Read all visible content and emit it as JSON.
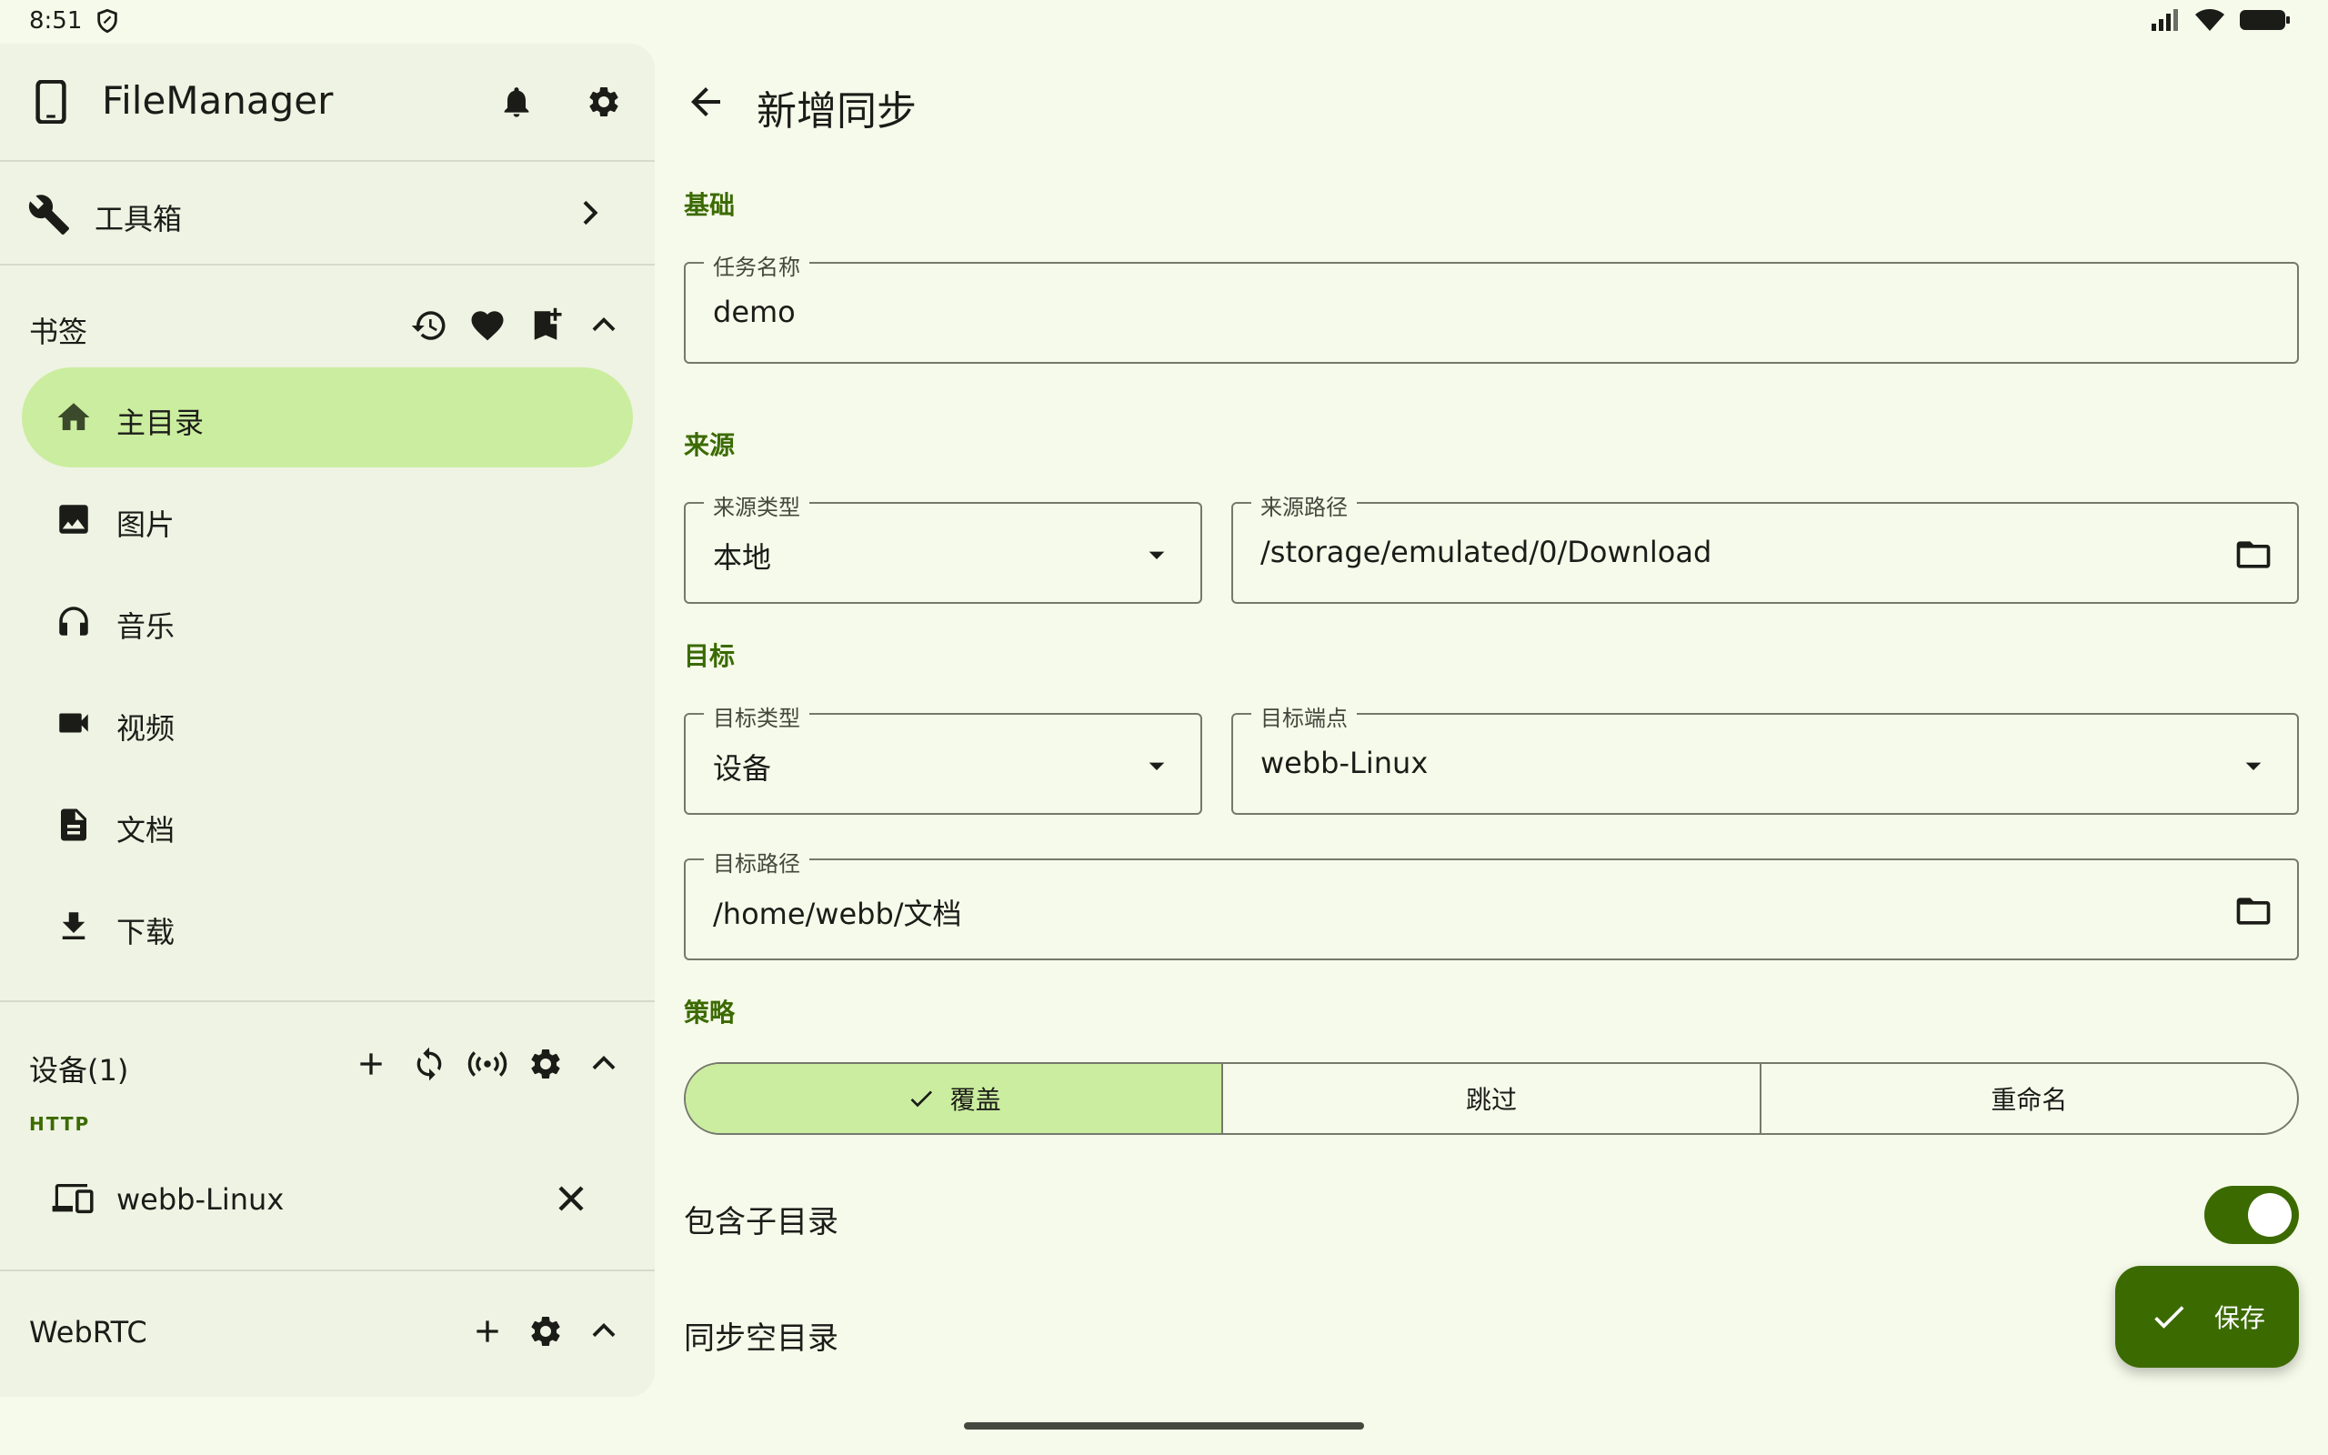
{
  "status_bar": {
    "time": "8:51",
    "icons": [
      "shield-icon",
      "signal-icon",
      "wifi-icon",
      "battery-icon"
    ]
  },
  "drawer": {
    "app_title": "FileManager",
    "header_icons": [
      "notifications-icon",
      "settings-icon"
    ],
    "toolbox_label": "工具箱",
    "bookmarks": {
      "title": "书签",
      "actions": [
        "history-icon",
        "favorite-icon",
        "bookmark-add-icon",
        "chevron-up-icon"
      ],
      "items": [
        {
          "label": "主目录",
          "icon": "home-icon",
          "active": true
        },
        {
          "label": "图片",
          "icon": "image-icon",
          "active": false
        },
        {
          "label": "音乐",
          "icon": "headphones-icon",
          "active": false
        },
        {
          "label": "视频",
          "icon": "videocam-icon",
          "active": false
        },
        {
          "label": "文档",
          "icon": "description-icon",
          "active": false
        },
        {
          "label": "下载",
          "icon": "download-icon",
          "active": false
        }
      ]
    },
    "devices": {
      "title": "设备(1)",
      "actions": [
        "add-icon",
        "sync-icon",
        "broadcast-icon",
        "settings-icon",
        "chevron-up-icon"
      ],
      "protocol_label": "HTTP",
      "items": [
        {
          "label": "webb-Linux",
          "icon": "devices-icon"
        }
      ]
    },
    "webrtc": {
      "title": "WebRTC",
      "actions": [
        "add-icon",
        "settings-icon",
        "chevron-up-icon"
      ]
    }
  },
  "main": {
    "title": "新增同步",
    "sections": {
      "basic": "基础",
      "source": "来源",
      "target": "目标",
      "strategy": "策略"
    },
    "fields": {
      "task_name": {
        "label": "任务名称",
        "value": "demo"
      },
      "source_type": {
        "label": "来源类型",
        "value": "本地"
      },
      "source_path": {
        "label": "来源路径",
        "value": "/storage/emulated/0/Download"
      },
      "target_type": {
        "label": "目标类型",
        "value": "设备"
      },
      "target_endpoint": {
        "label": "目标端点",
        "value": "webb-Linux"
      },
      "target_path": {
        "label": "目标路径",
        "value": "/home/webb/文档"
      }
    },
    "strategy_options": [
      {
        "label": "覆盖",
        "selected": true
      },
      {
        "label": "跳过",
        "selected": false
      },
      {
        "label": "重命名",
        "selected": false
      }
    ],
    "include_subdirs": {
      "label": "包含子目录",
      "on": true
    },
    "sync_empty_dirs": {
      "label": "同步空目录"
    },
    "save_button": "保存"
  },
  "colors": {
    "background": "#f6faea",
    "drawer": "#eff3e3",
    "accent": "#3b6a00",
    "selected": "#cbed9f"
  }
}
